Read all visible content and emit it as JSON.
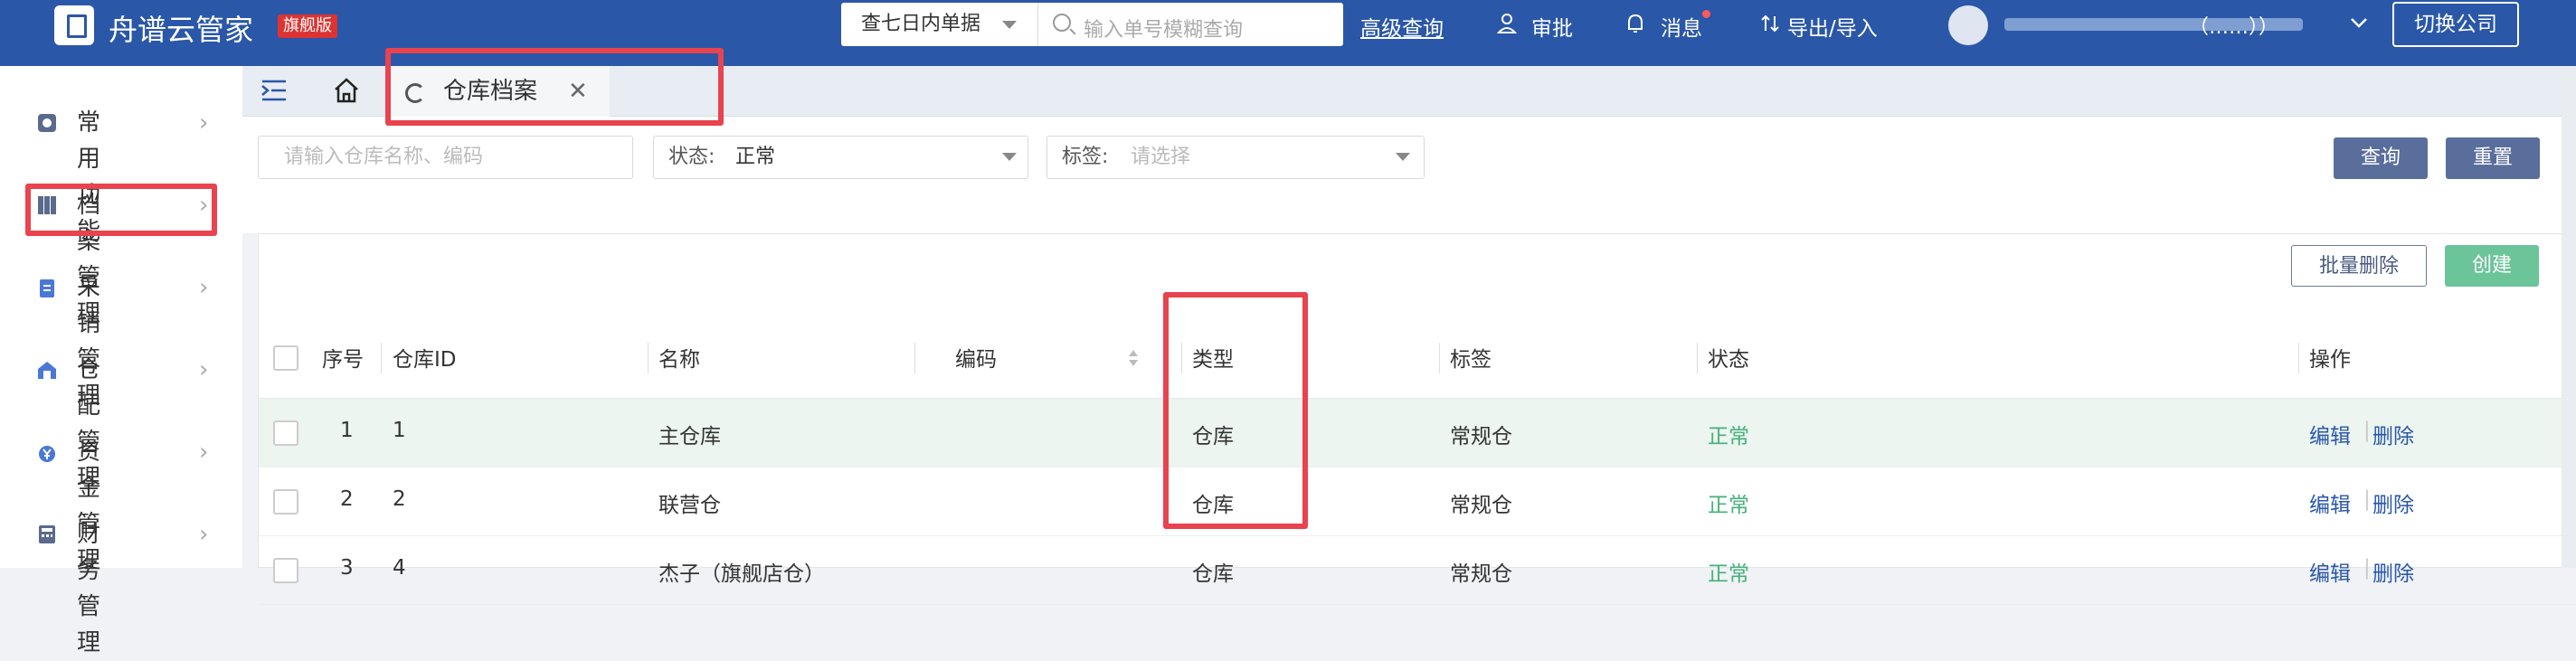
{
  "header": {
    "app_name": "舟谱云管家",
    "edition": "旗舰版",
    "search_scope": "查七日内单据",
    "search_placeholder": "输入单号模糊查询",
    "advanced_search": "高级查询",
    "approval": "审批",
    "messages": "消息",
    "export_import": "导出/导入",
    "user_suffix": "（……））",
    "switch_company": "切换公司"
  },
  "sidebar": {
    "items": [
      {
        "label": "常用功能"
      },
      {
        "label": "档案管理"
      },
      {
        "label": "采销管理"
      },
      {
        "label": "仓配管理"
      },
      {
        "label": "资金管理"
      },
      {
        "label": "财务管理"
      }
    ]
  },
  "tabs": [
    {
      "label": "仓库档案"
    }
  ],
  "filters": {
    "name_placeholder": "请输入仓库名称、编码",
    "status_label": "状态:",
    "status_value": "正常",
    "tag_label": "标签:",
    "tag_placeholder": "请选择",
    "query_button": "查询",
    "reset_button": "重置"
  },
  "toolbar": {
    "batch_delete": "批量删除",
    "create": "创建"
  },
  "table": {
    "headers": {
      "index": "序号",
      "id": "仓库ID",
      "name": "名称",
      "code": "编码",
      "type": "类型",
      "tag": "标签",
      "status": "状态",
      "ops": "操作"
    },
    "rows": [
      {
        "index": "1",
        "id": "1",
        "name": "主仓库",
        "code": "",
        "type": "仓库",
        "tag": "常规仓",
        "status": "正常",
        "edit": "编辑",
        "delete": "删除"
      },
      {
        "index": "2",
        "id": "2",
        "name": "联营仓",
        "code": "",
        "type": "仓库",
        "tag": "常规仓",
        "status": "正常",
        "edit": "编辑",
        "delete": "删除"
      },
      {
        "index": "3",
        "id": "4",
        "name": "杰子（旗舰店仓）",
        "code": "",
        "type": "仓库",
        "tag": "常规仓",
        "status": "正常",
        "edit": "编辑",
        "delete": "删除"
      }
    ]
  },
  "colors": {
    "header_bg": "#2a57a8",
    "primary_button": "#5a6e9b",
    "create_button": "#6cc49a",
    "status_ok": "#45b07a",
    "highlight_box": "#e8434e"
  }
}
